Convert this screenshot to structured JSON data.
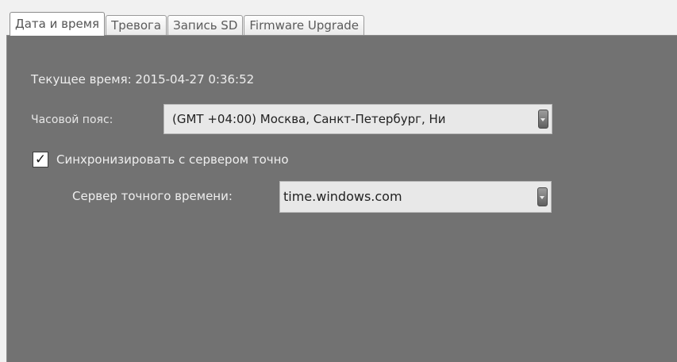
{
  "tabs": [
    {
      "label": "Дата и время",
      "active": true
    },
    {
      "label": "Тревога",
      "active": false
    },
    {
      "label": "Запись SD",
      "active": false
    },
    {
      "label": "Firmware Upgrade",
      "active": false
    }
  ],
  "datetime": {
    "current_time_text": "Текущее время: 2015-04-27 0:36:52",
    "timezone_label": "Часовой пояс:",
    "timezone_value": "(GMT +04:00) Москва, Санкт-Петербург, Ни",
    "sync_checked": true,
    "sync_check_mark": "✓",
    "sync_label": "Синхронизировать с сервером точно",
    "ntp_label": "Сервер точного времени:",
    "ntp_value": "time.windows.com"
  },
  "icons": {
    "dropdown": "chevron-down-icon",
    "checkbox": "checkmark-icon"
  },
  "colors": {
    "panel_bg": "#727272",
    "window_bg": "#f1f1f1",
    "input_bg": "#e8e8e8"
  }
}
